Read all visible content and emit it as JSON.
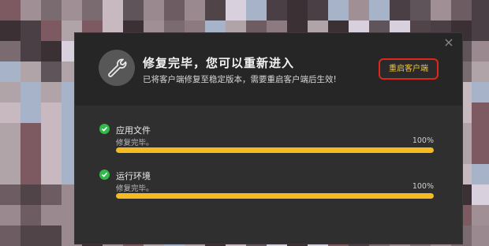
{
  "dialog": {
    "title": "修复完毕，您可以重新进入",
    "subtitle": "已将客户端修复至稳定版本，需要重启客户端后生效!",
    "restart_label": "重启客户端",
    "close_icon": "close-icon",
    "header_icon": "wrench-icon"
  },
  "items": [
    {
      "name": "应用文件",
      "status": "修复完毕。",
      "percent_label": "100%",
      "progress": 1.0
    },
    {
      "name": "运行环境",
      "status": "修复完毕。",
      "percent_label": "100%",
      "progress": 1.0
    }
  ],
  "colors": {
    "accent": "#f4bb23",
    "check": "#33b84a",
    "highlight": "#e0251b"
  }
}
